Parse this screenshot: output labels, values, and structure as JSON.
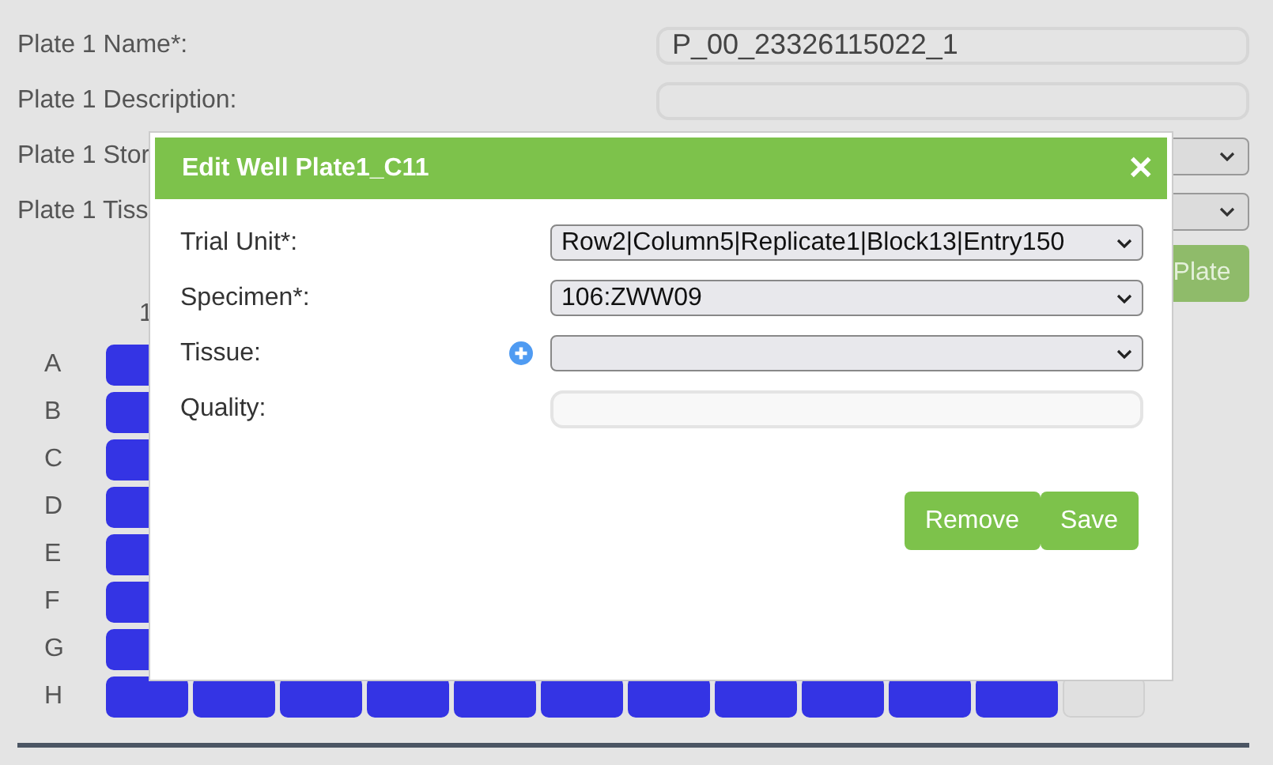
{
  "form": [
    {
      "label": "Plate 1 Name*:",
      "kind": "text",
      "value": "P_00_23326115022_1"
    },
    {
      "label": "Plate 1 Description:",
      "kind": "text"
    },
    {
      "label": "Plate 1 Stor",
      "kind": "select"
    },
    {
      "label": "Plate 1 Tiss",
      "kind": "select"
    }
  ],
  "plate_button": "Plate",
  "plate": {
    "column_header": "1",
    "rows": [
      {
        "label": "A",
        "wells": [
          {
            "filled": true
          }
        ]
      },
      {
        "label": "B",
        "wells": [
          {
            "filled": true
          }
        ]
      },
      {
        "label": "C",
        "wells": [
          {
            "filled": true
          }
        ]
      },
      {
        "label": "D",
        "wells": [
          {
            "filled": true
          }
        ]
      },
      {
        "label": "E",
        "wells": [
          {
            "filled": true
          }
        ]
      },
      {
        "label": "F",
        "wells": [
          {
            "filled": true
          }
        ]
      },
      {
        "label": "G",
        "wells": [
          {
            "filled": true
          }
        ]
      },
      {
        "label": "H",
        "wells": [
          {
            "filled": true
          },
          {
            "filled": true
          },
          {
            "filled": true
          },
          {
            "filled": true
          },
          {
            "filled": true
          },
          {
            "filled": true
          },
          {
            "filled": true
          },
          {
            "filled": true
          },
          {
            "filled": true
          },
          {
            "filled": true
          },
          {
            "filled": true
          },
          {
            "filled": false
          }
        ]
      }
    ]
  },
  "dialog": {
    "title": "Edit Well Plate1_C11",
    "close": "✕",
    "fields": [
      {
        "label": "Trial Unit*:",
        "kind": "select",
        "value": "Row2|Column5|Replicate1|Block13|Entry150",
        "add": false
      },
      {
        "label": "Specimen*:",
        "kind": "select",
        "value": "106:ZWW09",
        "add": false
      },
      {
        "label": "Tissue:",
        "kind": "select",
        "add": true
      },
      {
        "label": "Quality:",
        "kind": "text",
        "add": false
      }
    ],
    "buttons": [
      "Remove",
      "Save"
    ]
  }
}
